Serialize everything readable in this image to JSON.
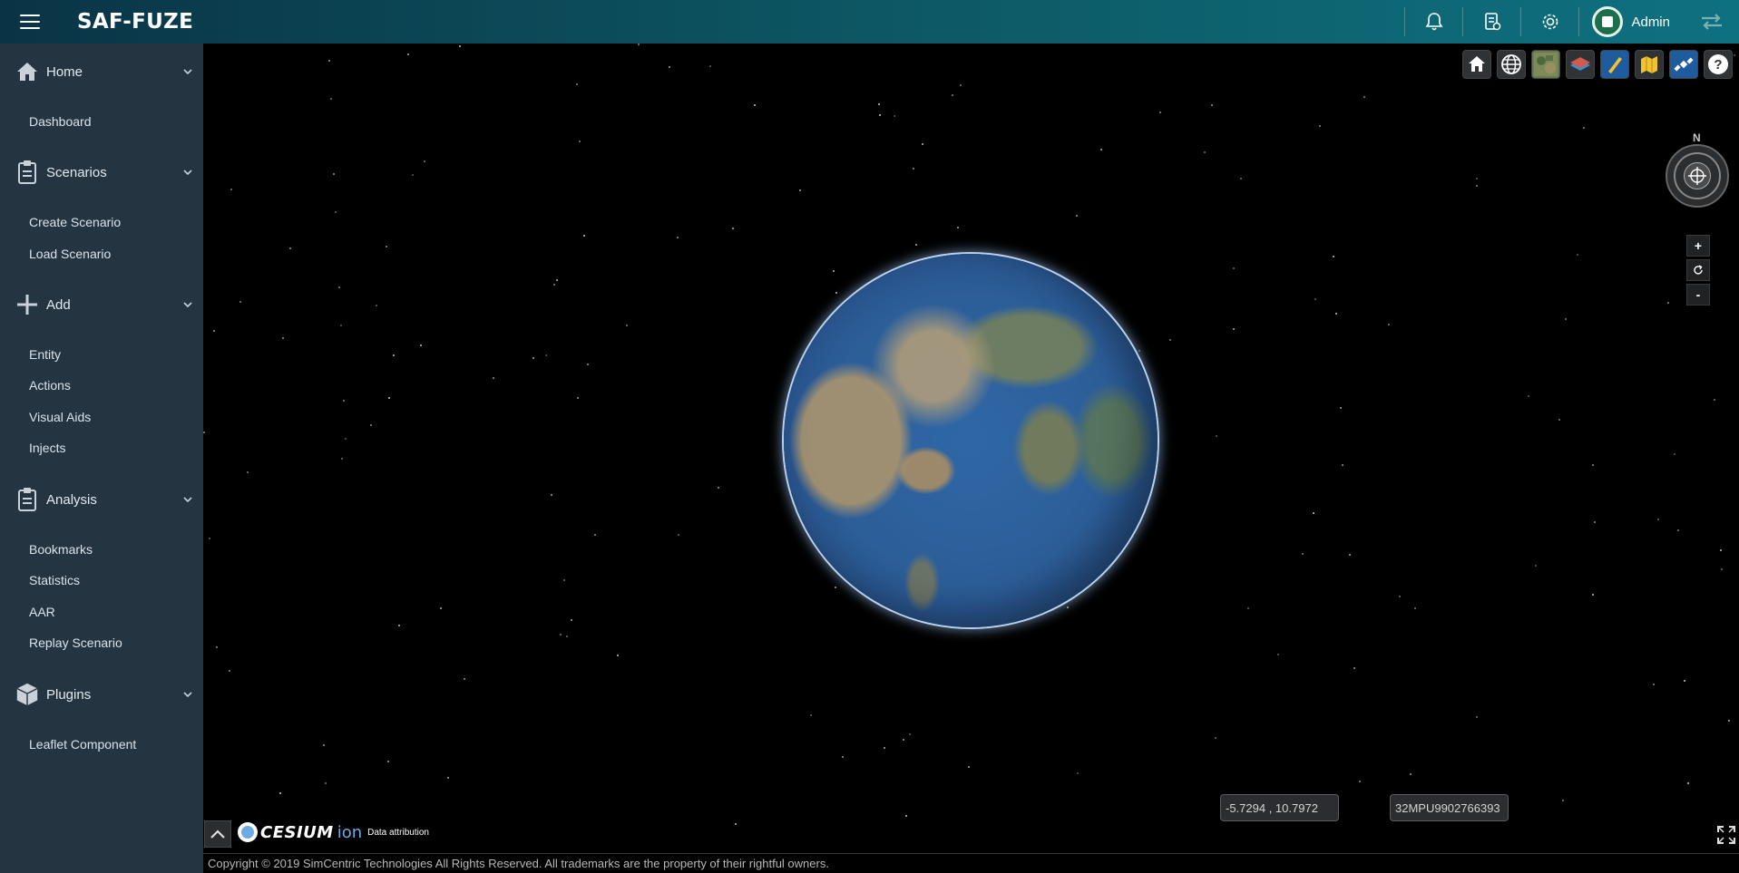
{
  "header": {
    "brand": "SAF-FUZE",
    "user_name": "Admin",
    "icons": [
      "menu-icon",
      "bell-icon",
      "report-icon",
      "gear-icon",
      "avatar",
      "swap-icon"
    ]
  },
  "sidebar": {
    "sections": [
      {
        "label": "Home",
        "icon": "home-icon",
        "items": [
          "Dashboard"
        ]
      },
      {
        "label": "Scenarios",
        "icon": "clipboard-icon",
        "items": [
          "Create Scenario",
          "Load Scenario"
        ]
      },
      {
        "label": "Add",
        "icon": "plus-icon",
        "items": [
          "Entity",
          "Actions",
          "Visual Aids",
          "Injects"
        ]
      },
      {
        "label": "Analysis",
        "icon": "clipboard-icon",
        "items": [
          "Bookmarks",
          "Statistics",
          "AAR",
          "Replay Scenario"
        ]
      },
      {
        "label": "Plugins",
        "icon": "cube-icon",
        "items": [
          "Leaflet Component"
        ]
      }
    ]
  },
  "map": {
    "toolbar": [
      "home-view-icon",
      "globe-icon",
      "imagery-icon",
      "layers-icon",
      "measure-icon",
      "map-icon",
      "satellite-icon",
      "help-icon"
    ],
    "compass_label": "N",
    "zoom_in": "+",
    "zoom_out": "-",
    "lat_lon": "-5.7294 , 10.7972",
    "mgrs": "32MPU9902766393",
    "logo_word": "CESIUM",
    "logo_ion": "ion",
    "attribution": "Data attribution"
  },
  "footer": {
    "copyright": "Copyright © 2019 SimCentric Technologies All Rights Reserved. All trademarks are the property of their rightful owners."
  },
  "colors": {
    "sidebar_bg": "#253441",
    "header_start": "#0a3446",
    "header_end": "#0e7180",
    "ion_blue": "#6dabe4"
  }
}
